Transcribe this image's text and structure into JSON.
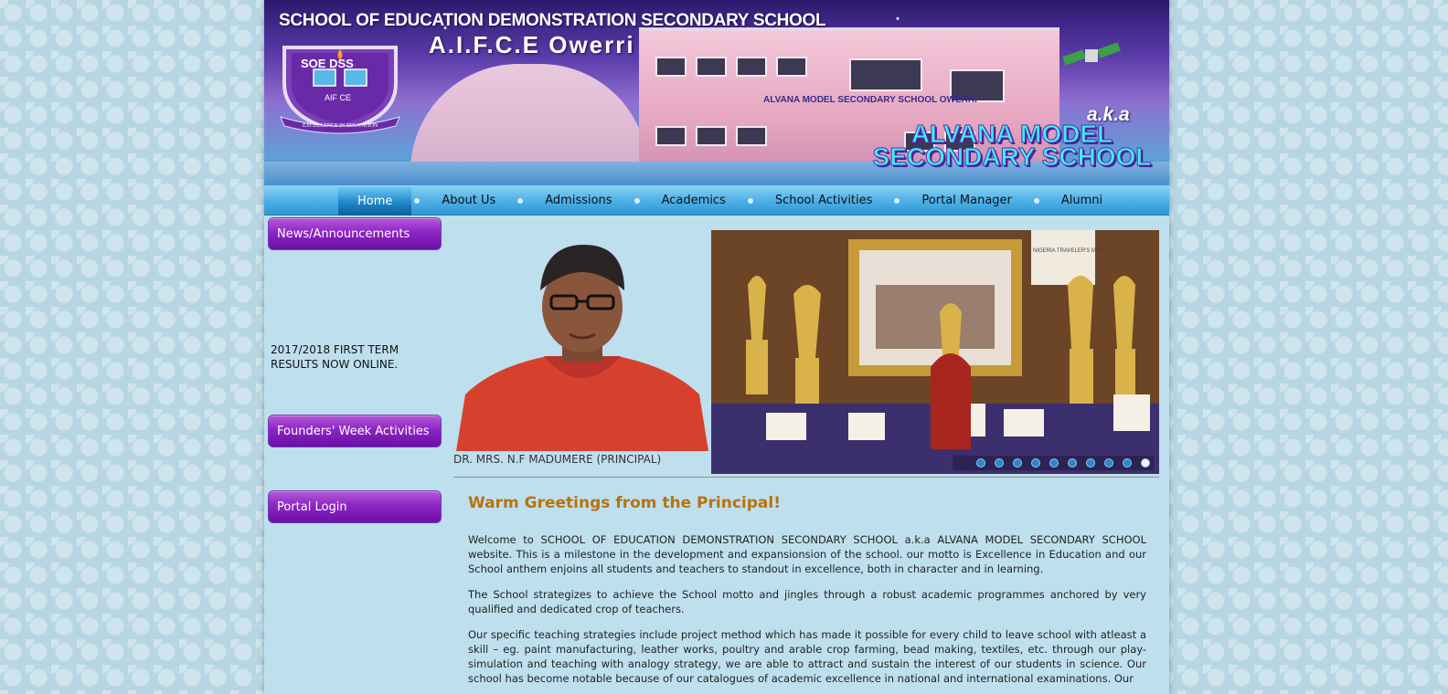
{
  "header": {
    "title": "SCHOOL OF EDUCATION DEMONSTRATION SECONDARY SCHOOL",
    "subtitle": "A.I.F.C.E Owerri",
    "logo_text_top": "SOE DSS",
    "logo_text_mid": "AIF CE",
    "logo_motto": "EXCELLENCE IN EDUCATION",
    "building_sign": "ALVANA MODEL SECONDARY SCHOOL OWERRI",
    "aka": "a.k.a",
    "alias_line1": "ALVANA MODEL",
    "alias_line2": "SECONDARY SCHOOL"
  },
  "nav": {
    "items": [
      {
        "label": "Home",
        "active": true
      },
      {
        "label": "About Us"
      },
      {
        "label": "Admissions"
      },
      {
        "label": "Academics"
      },
      {
        "label": "School Activities"
      },
      {
        "label": "Portal Manager"
      },
      {
        "label": "Alumni"
      }
    ]
  },
  "sidebar": {
    "news_button": "News/Announcements",
    "news_text": "2017/2018 FIRST TERM RESULTS NOW ONLINE.",
    "founders_button": "Founders' Week Activities",
    "portal_button": "Portal Login"
  },
  "principal": {
    "caption": "DR. MRS. N.F MADUMERE (PRINCIPAL)"
  },
  "slider": {
    "dot_count": 10,
    "active_index": 9,
    "photo_sign": "NIGERIA TRAVELER'S MAP"
  },
  "article": {
    "title": "Warm Greetings from the Principal!",
    "paragraphs": [
      "Welcome to SCHOOL OF EDUCATION DEMONSTRATION SECONDARY SCHOOL a.k.a ALVANA MODEL SECONDARY SCHOOL website. This is a milestone in the development and expansionsion of the school. our motto is Excellence in Education and our School anthem enjoins all students and teachers to standout in excellence, both in character and in learning.",
      "The School strategizes to achieve the School motto and jingles through a robust academic programmes anchored by very qualified and dedicated crop of teachers.",
      "Our specific teaching strategies include project method which has made it possible for every child to leave school with atleast a skill – eg. paint manufacturing, leather works, poultry and arable crop farming, bead making, textiles, etc. through our play-simulation and teaching with analogy strategy, we are able to attract and sustain the interest of our students in science. Our school has become notable because of our catalogues of academic excellence in national and international examinations. Our"
    ]
  },
  "colors": {
    "nav_active": "#1f87c9",
    "sidebar_button": "#8d25c4",
    "article_title": "#b8730d",
    "page_bg": "#bedfee"
  }
}
